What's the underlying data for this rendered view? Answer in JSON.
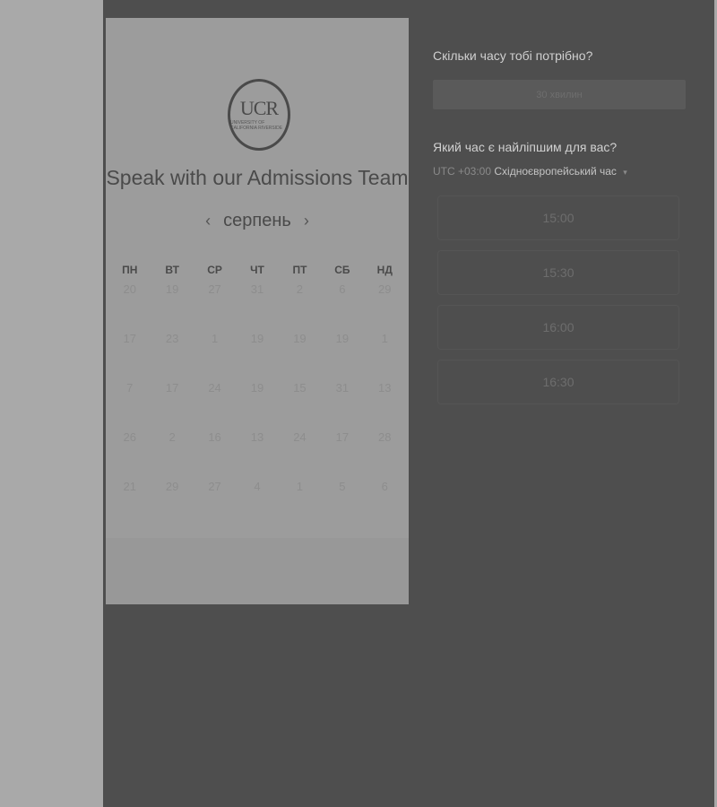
{
  "topbar": {
    "text": ""
  },
  "logo": {
    "main": "UCR",
    "sub": "UNIVERSITY OF CALIFORNIA RIVERSIDE"
  },
  "left": {
    "title": "Speak with our Admissions Team",
    "month": "серпень",
    "prev_icon": "chevron-left-icon",
    "next_icon": "chevron-right-icon",
    "weekdays": [
      "ПН",
      "ВТ",
      "СР",
      "ЧТ",
      "ПТ",
      "СБ",
      "НД"
    ],
    "weeks": [
      [
        "20",
        "19",
        "27",
        "31",
        "2",
        "6",
        "29"
      ],
      [
        "17",
        "23",
        "1",
        "19",
        "19",
        "19",
        "1"
      ],
      [
        "7",
        "17",
        "24",
        "19",
        "15",
        "31",
        "13"
      ],
      [
        "26",
        "2",
        "16",
        "13",
        "24",
        "17",
        "28"
      ],
      [
        "21",
        "29",
        "27",
        "4",
        "1",
        "5",
        "6"
      ]
    ]
  },
  "right": {
    "question_duration": "Скільки часу тобі потрібно?",
    "duration_value": "30 хвилин",
    "question_time": "Який час є найліпшим для вас?",
    "timezone_label": "UTC +03:00",
    "timezone_name": "Східноєвропейський час",
    "timezone_caret": "▾",
    "slots": [
      "15:00",
      "15:30",
      "16:00",
      "16:30"
    ]
  }
}
